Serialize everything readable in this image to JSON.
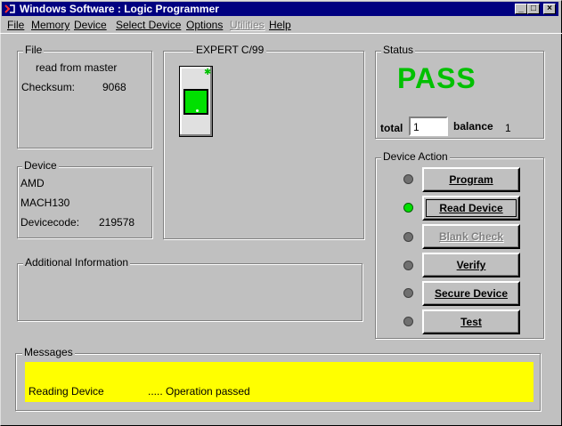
{
  "window": {
    "title": "Windows Software :  Logic Programmer",
    "title_color": "#000080"
  },
  "menu": [
    {
      "label": "File",
      "enabled": true
    },
    {
      "label": "Memory",
      "enabled": true
    },
    {
      "label": "Device",
      "enabled": true
    },
    {
      "label": "Select Device",
      "enabled": true
    },
    {
      "label": "Options",
      "enabled": true
    },
    {
      "label": "Utilities",
      "enabled": false
    },
    {
      "label": "Help",
      "enabled": true
    }
  ],
  "file_group": {
    "label": "File",
    "source": "read from master",
    "checksum_label": "Checksum:",
    "checksum_value": "9068"
  },
  "expert_group": {
    "label": "EXPERT  C/99"
  },
  "status_group": {
    "label": "Status",
    "result": "PASS",
    "result_color": "#00c000",
    "total_label": "total",
    "total_value": "1",
    "balance_label": "balance",
    "balance_value": "1"
  },
  "device_group": {
    "label": "Device",
    "manufacturer": "AMD",
    "part": "MACH130",
    "devicecode_label": "Devicecode:",
    "devicecode_value": "219578"
  },
  "device_action": {
    "label": "Device Action",
    "buttons": [
      {
        "label": "Program",
        "led": "off",
        "enabled": true
      },
      {
        "label": "Read Device",
        "led": "on",
        "enabled": true,
        "focused": true
      },
      {
        "label": "Blank Check",
        "led": "off",
        "enabled": false
      },
      {
        "label": "Verify",
        "led": "off",
        "enabled": true
      },
      {
        "label": "Secure Device",
        "led": "off",
        "enabled": true
      },
      {
        "label": "Test",
        "led": "off",
        "enabled": true
      }
    ]
  },
  "additional_info": {
    "label": "Additional Information"
  },
  "messages": {
    "label": "Messages",
    "line_left": "Reading Device",
    "line_right": "..... Operation passed",
    "background": "#ffff00"
  }
}
